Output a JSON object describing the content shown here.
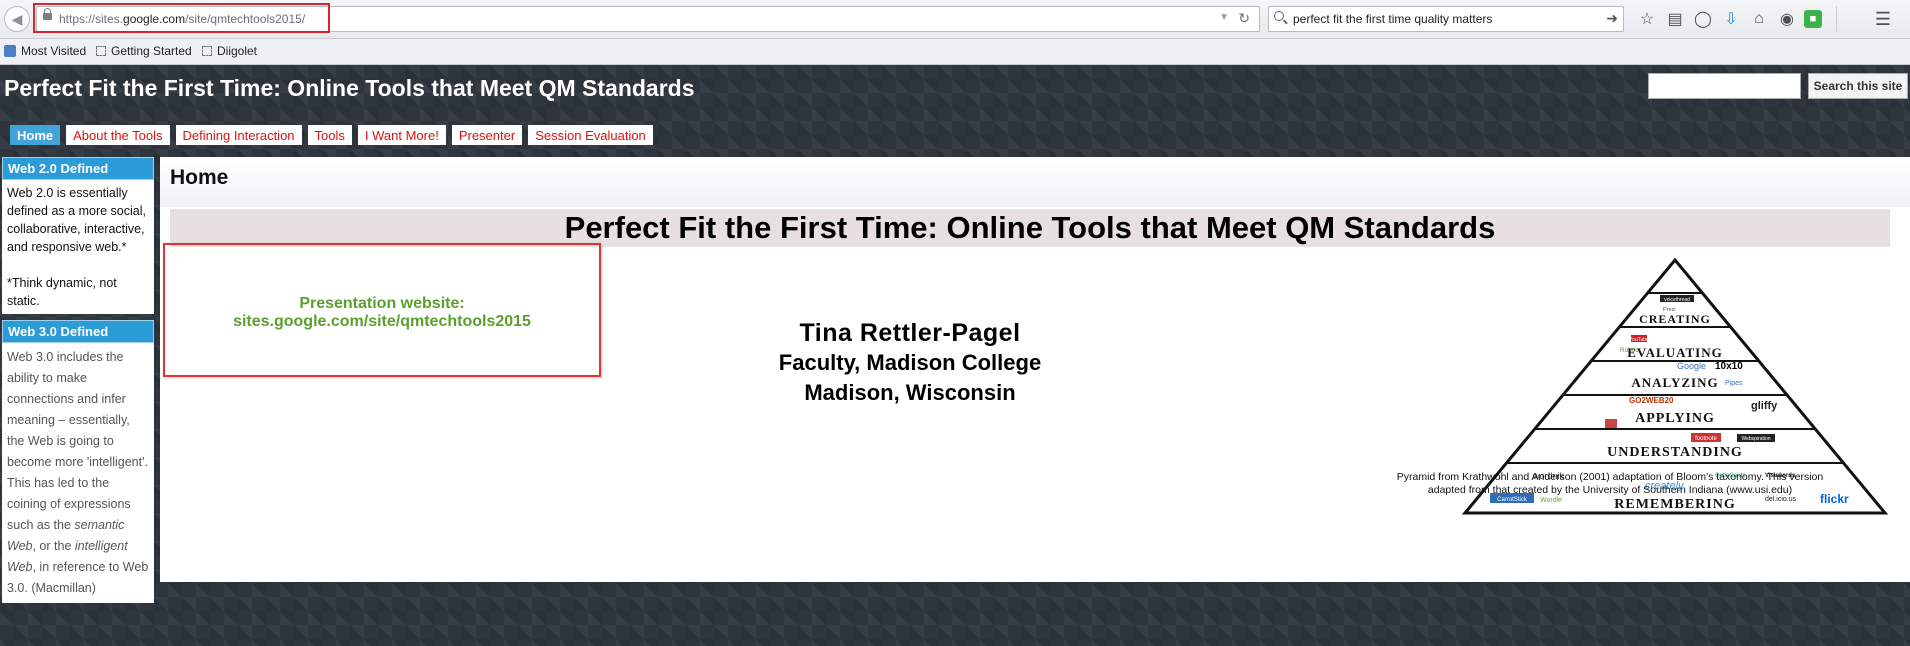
{
  "browser": {
    "url_prefix": "https://sites.",
    "url_domain": "google.com",
    "url_path": "/site/qmtechtools2015/",
    "search_query": "perfect fit the first time quality matters",
    "bookmarks": [
      "Most Visited",
      "Getting Started",
      "Diigolet"
    ]
  },
  "site": {
    "title": "Perfect Fit the First Time: Online Tools that Meet QM Standards",
    "search_button": "Search this site",
    "nav": [
      "Home",
      "About the Tools",
      "Defining Interaction",
      "Tools",
      "I Want More!",
      "Presenter",
      "Session Evaluation"
    ],
    "nav_active": "Home"
  },
  "sidebar": {
    "web2": {
      "title": "Web 2.0 Defined",
      "text": "Web 2.0 is essentially defined as a more social, collaborative, interactive, and responsive web.*",
      "note": "*Think dynamic, not static."
    },
    "web3": {
      "title": "Web 3.0 Defined",
      "text_a": "Web 3.0 includes the ability to make connections and infer meaning – essentially, the Web is going to become more 'intelligent'. This has led to the coining of expressions such as the ",
      "em_1": "semantic Web",
      "text_b": ", or the ",
      "em_2": "intelligent Web",
      "text_c": ", in reference to Web 3.0. (Macmillan)"
    }
  },
  "content": {
    "page_title": "Home",
    "banner": "Perfect Fit the First Time: Online Tools that Meet QM Standards",
    "presentation_label": "Presentation website:",
    "presentation_url": "sites.google.com/site/qmtechtools2015",
    "presenter_name": "Tina Rettler-Pagel",
    "presenter_role": "Faculty, Madison College",
    "presenter_location": "Madison, Wisconsin",
    "pyramid_levels": [
      "Creating",
      "Evaluating",
      "Analyzing",
      "Applying",
      "Understanding",
      "Remembering"
    ],
    "pyramid_tools": [
      "voicethread",
      "Prezi",
      "YouTube",
      "Rubric",
      "Google",
      "10x10",
      "Pipes",
      "GO2WEB20",
      "gliffy",
      "Google Maps",
      "footnote",
      "Webspiration",
      "wordnik",
      "CobeCards",
      "Visuwords",
      "CarrotStick",
      "Wordle",
      "del.icio.us",
      "flickr",
      "creately"
    ],
    "caption_line1": "Pyramid from Krathwohl and Anderson (2001) adaptation of Bloom's taxonomy.   This version",
    "caption_line2": "adapted from that created by the University of Southern Indiana (www.usi.edu)"
  },
  "colors": {
    "nav_active": "#41a3d6",
    "nav_text": "#d11111",
    "gadget_title": "#2b9cd8",
    "presentation_text": "#5aa02c",
    "highlight": "#d9232e"
  }
}
